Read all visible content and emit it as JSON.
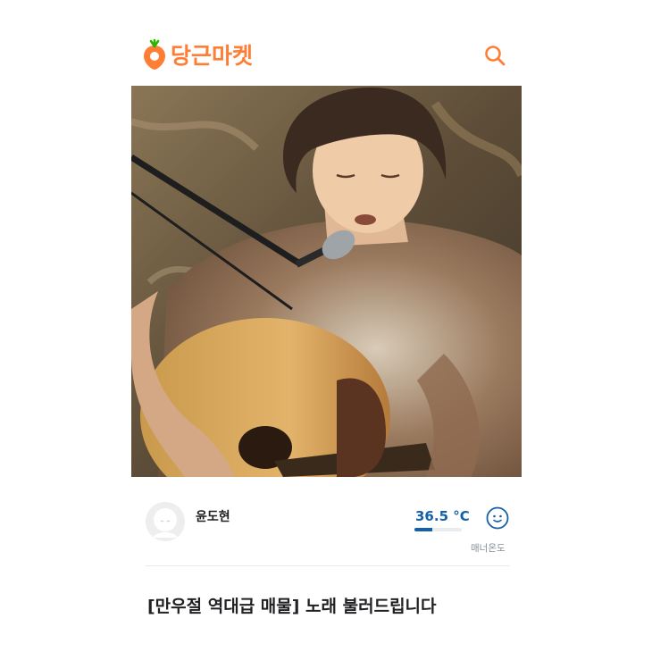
{
  "header": {
    "logo_text": "당근마켓",
    "logo_icon": "carrot-icon",
    "search_icon": "search-icon",
    "accent_color": "#ff7e36"
  },
  "post": {
    "image_description": "singer-with-acoustic-guitar-and-microphone",
    "title": "[만우절 역대급 매물] 노래 불러드립니다"
  },
  "seller": {
    "nickname": "윤도현",
    "avatar_icon": "default-avatar-icon",
    "manner_temperature": "36.5 °C",
    "manner_temperature_value": 36.5,
    "manner_label": "매너온도",
    "face_icon": "smile-face-icon",
    "temperature_color": "#1561a9"
  }
}
